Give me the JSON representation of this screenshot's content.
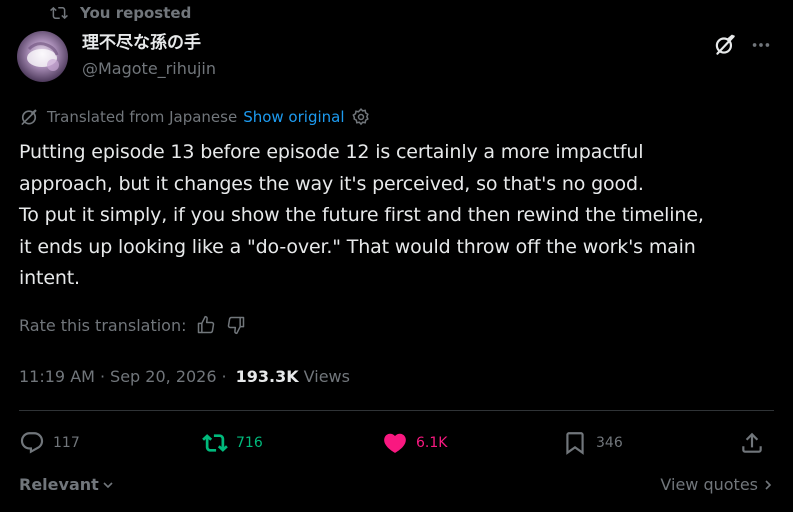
{
  "repost": {
    "label": "You reposted"
  },
  "author": {
    "display_name": "理不尽な孫の手",
    "handle": "@Magote_rihujin"
  },
  "translation": {
    "label": "Translated from Japanese",
    "show_original": "Show original"
  },
  "tweet": {
    "lines": [
      "Putting episode 13 before episode 12 is certainly a more impactful",
      "approach, but it changes the way it's perceived, so that's no good.",
      "To put it simply, if you show the future first and then rewind the timeline,",
      "it ends up looking like a \"do-over.\" That would throw off the work's main",
      "intent."
    ]
  },
  "rate": {
    "label": "Rate this translation:"
  },
  "meta": {
    "time": "11:19 AM",
    "date": "Sep 20, 2026",
    "views_count": "193.3K",
    "views_label": "Views"
  },
  "actions": {
    "replies": "117",
    "reposts": "716",
    "likes": "6.1K",
    "bookmarks": "346"
  },
  "footer": {
    "sort_label": "Relevant",
    "view_quotes": "View quotes"
  },
  "colors": {
    "background": "#000000",
    "text": "#e7e9ea",
    "muted": "#71767b",
    "link": "#1d9bf0",
    "repost_green": "#00ba7c",
    "like_pink": "#f91880",
    "divider": "#2f3336"
  },
  "icons": [
    "repost-icon",
    "avatar",
    "grok-icon",
    "more-icon",
    "translate-globe-icon",
    "gear-icon",
    "thumbs-up-icon",
    "thumbs-down-icon",
    "reply-icon",
    "retweet-icon",
    "heart-icon",
    "bookmark-icon",
    "share-icon",
    "chevron-down-icon",
    "chevron-right-icon"
  ]
}
